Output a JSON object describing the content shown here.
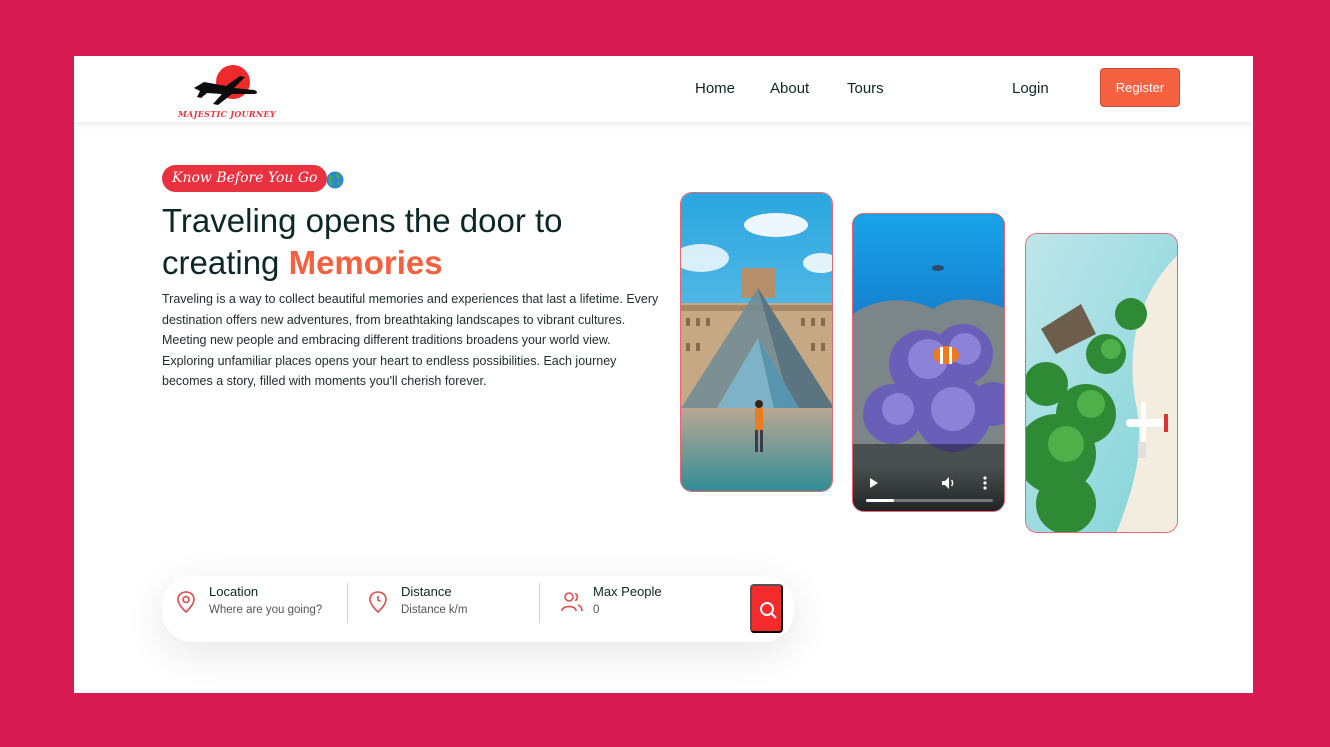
{
  "brand": {
    "name": "MAJESTIC JOURNEY",
    "accent": "#f6603f",
    "frame_bg": "#d81a52"
  },
  "nav": {
    "home": "Home",
    "about": "About",
    "tours": "Tours",
    "login": "Login",
    "register": "Register"
  },
  "hero": {
    "badge": "Know Before You Go",
    "title_part1": "Traveling opens the door to creating ",
    "title_highlight": "Memories",
    "description": "Traveling is a way to collect beautiful memories and experiences that last a lifetime. Every destination offers new adventures, from breathtaking landscapes to vibrant cultures. Meeting new people and embracing different traditions broadens your world view. Exploring unfamiliar places opens your heart to endless possibilities. Each journey becomes a story, filled with moments you'll cherish forever."
  },
  "media": {
    "video_progress_fraction": 0.22
  },
  "search": {
    "location_label": "Location",
    "location_placeholder": "Where are you going?",
    "distance_label": "Distance",
    "distance_placeholder": "Distance k/m",
    "people_label": "Max People",
    "people_placeholder": "0"
  }
}
